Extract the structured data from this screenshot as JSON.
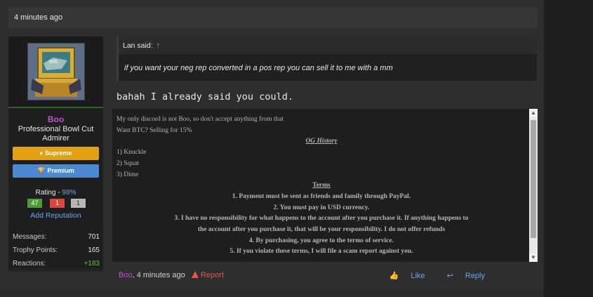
{
  "header": {
    "time": "4 minutes ago"
  },
  "user": {
    "username": "Boo",
    "title": "Professional Bowl Cut Admirer",
    "badges": [
      {
        "label": "Supreme",
        "color": "#e2a012",
        "icon": "diamond-icon"
      },
      {
        "label": "Premium",
        "color": "#4b8ad1",
        "icon": "trophy-icon"
      }
    ],
    "rating_label": "Rating - ",
    "rating_pct": "98%",
    "rating_boxes": {
      "positive": "47",
      "negative": "1",
      "neutral": "1"
    },
    "add_reputation": "Add Reputation",
    "stats": [
      {
        "label": "Messages:",
        "value": "701"
      },
      {
        "label": "Trophy Points:",
        "value": "165"
      },
      {
        "label": "Reactions:",
        "value": "+183"
      }
    ]
  },
  "quote": {
    "author": "Lan said:",
    "arrow": "↑",
    "text": "if you want your neg rep converted in a pos rep you can sell it to me with a mm"
  },
  "post": {
    "body": "bahah I already said you could."
  },
  "signature": {
    "lines": [
      "My only discord is not Boo, so don't accept anything from that",
      "Want BTC? Selling for 15%",
      "OG History",
      "1) Knuckle",
      "2) Squat",
      "3) Dime",
      "Terms",
      "1. Payment must be sent as friends and family through PayPal.",
      "2. You must pay in USD currency.",
      "3. I have no responsibility for what happens to the account after you purchase it. If anything happens to",
      "the account after you purchase it, that will be your responsibility. I do not offer refunds",
      "4. By purchasing, you agree to the terms of service.",
      "5. If you violate these terms, I will file a scam report against you."
    ]
  },
  "footer": {
    "user": "Boo",
    "time": ", 4 minutes ago",
    "report": "Report",
    "like": "Like",
    "reply": "Reply"
  },
  "colors": {
    "accent": "#6ba6e8",
    "username": "#c64bd8",
    "report": "#e05a4b"
  }
}
